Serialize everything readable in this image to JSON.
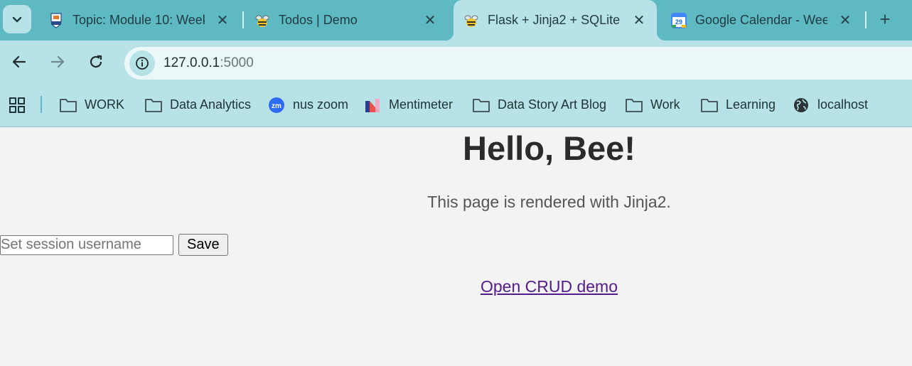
{
  "tabs": [
    {
      "title": "Topic: Module 10: Week",
      "favicon": "nus-logo-icon"
    },
    {
      "title": "Todos | Demo",
      "favicon": "bee-icon"
    },
    {
      "title": "Flask + Jinja2 + SQLite",
      "favicon": "bee-icon",
      "active": true
    },
    {
      "title": "Google Calendar - Wee",
      "favicon": "calendar-icon",
      "calendar_day": "29"
    }
  ],
  "address": {
    "host": "127.0.0.1",
    "port": ":5000"
  },
  "bookmarks": [
    {
      "label": "WORK",
      "icon": "folder-icon"
    },
    {
      "label": "Data Analytics",
      "icon": "folder-icon"
    },
    {
      "label": "nus zoom",
      "icon": "zoom-icon",
      "icon_text": "zm"
    },
    {
      "label": "Mentimeter",
      "icon": "mentimeter-icon"
    },
    {
      "label": "Data Story Art Blog",
      "icon": "folder-icon"
    },
    {
      "label": "Work",
      "icon": "folder-icon"
    },
    {
      "label": "Learning",
      "icon": "folder-icon"
    },
    {
      "label": "localhost",
      "icon": "globe-icon"
    }
  ],
  "page": {
    "heading": "Hello, Bee!",
    "subtitle": "This page is rendered with Jinja2.",
    "username_placeholder": "Set session username",
    "save_label": "Save",
    "crud_link": "Open CRUD demo"
  },
  "colors": {
    "tabstrip": "#5fb9c2",
    "toolbar": "#b7e2e7",
    "page_bg": "#f3f3f3",
    "visited_link": "#551a8b"
  }
}
